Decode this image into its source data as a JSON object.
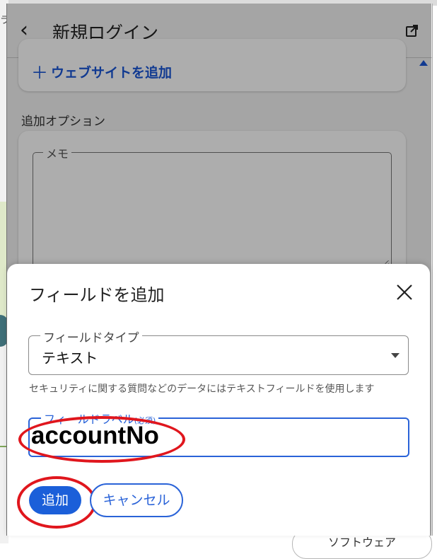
{
  "background": {
    "left_char": "ラ",
    "bottom_button": "ソフトウェア"
  },
  "header": {
    "title": "新規ログイン"
  },
  "website_card": {
    "add_link": "ウェブサイトを追加"
  },
  "options_section": {
    "label": "追加オプション",
    "memo_label": "メモ"
  },
  "dialog": {
    "title": "フィールドを追加",
    "field_type": {
      "label": "フィールドタイプ",
      "value": "テキスト"
    },
    "helper_text": "セキュリティに関する質問などのデータにはテキストフィールドを使用します",
    "field_label": {
      "label": "フィールドラベル",
      "required": "(必須)",
      "value": "accountNo"
    },
    "add_button": "追加",
    "cancel_button": "キャンセル"
  },
  "colors": {
    "accent": "#1b5fd9",
    "annotation_red": "#e0161d"
  }
}
